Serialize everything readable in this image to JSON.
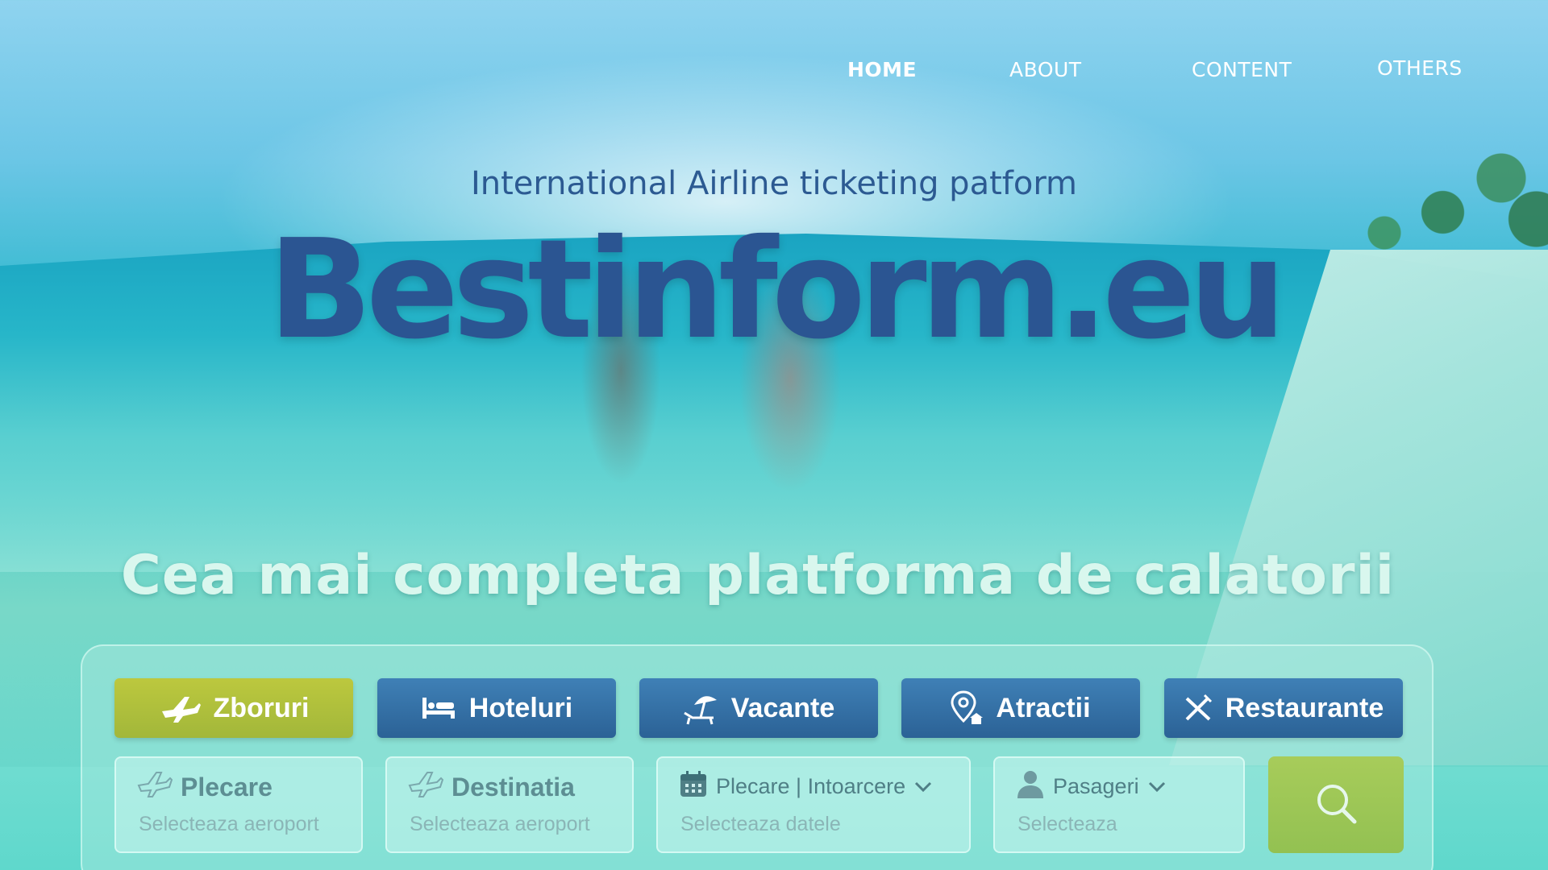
{
  "nav": {
    "items": [
      {
        "label": "HOME",
        "active": true
      },
      {
        "label": "ABOUT",
        "active": false
      },
      {
        "label": "CONTENT",
        "active": false
      },
      {
        "label": "OTHERS",
        "active": false
      }
    ]
  },
  "hero": {
    "tagline": "International Airline ticketing patform",
    "brand": "Bestinform.eu",
    "headline": "Cea mai completa platforma de calatorii"
  },
  "tabs": [
    {
      "label": "Zboruri",
      "icon": "airplane-icon",
      "active": true
    },
    {
      "label": "Hoteluri",
      "icon": "bed-icon",
      "active": false
    },
    {
      "label": "Vacante",
      "icon": "beach-umbrella-icon",
      "active": false
    },
    {
      "label": "Atractii",
      "icon": "location-pin-icon",
      "active": false
    },
    {
      "label": "Restaurante",
      "icon": "cutlery-icon",
      "active": false
    }
  ],
  "search": {
    "departure": {
      "label": "Plecare",
      "placeholder": "Selecteaza aeroport",
      "icon": "airplane-outline-icon"
    },
    "destination": {
      "label": "Destinatia",
      "placeholder": "Selecteaza aeroport",
      "icon": "airplane-outline-icon"
    },
    "dates": {
      "label": "Plecare | Intoarcere",
      "placeholder": "Selecteaza datele",
      "icon": "calendar-icon"
    },
    "passengers": {
      "label": "Pasageri",
      "placeholder": "Selecteaza",
      "icon": "person-icon"
    },
    "button_icon": "search-icon"
  },
  "colors": {
    "brand": "#2b5592",
    "tab": "#2b6296",
    "tab_active": "#a2b73a",
    "search_button": "#93c152"
  }
}
